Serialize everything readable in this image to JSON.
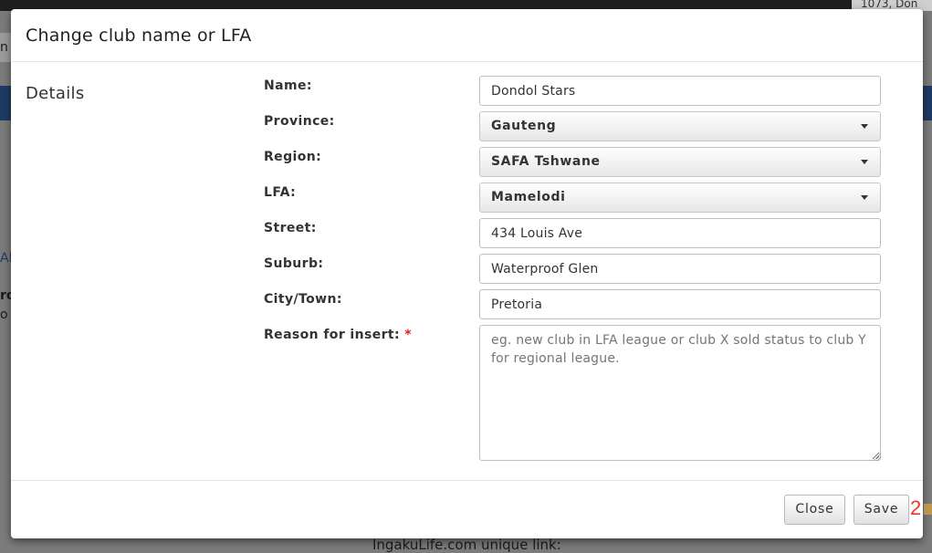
{
  "background": {
    "topbar_text": "1073, Don",
    "left_fragments": [
      "n",
      "AF",
      "ro",
      "o"
    ],
    "bottom_text": "IngakuLife.com unique link:"
  },
  "modal": {
    "title": "Change club name or LFA",
    "section_title": "Details",
    "fields": {
      "name": {
        "label": "Name:",
        "value": "Dondol Stars"
      },
      "province": {
        "label": "Province:",
        "value": "Gauteng"
      },
      "region": {
        "label": "Region:",
        "value": "SAFA Tshwane"
      },
      "lfa": {
        "label": "LFA:",
        "value": "Mamelodi"
      },
      "street": {
        "label": "Street:",
        "value": "434 Louis Ave"
      },
      "suburb": {
        "label": "Suburb:",
        "value": "Waterproof Glen"
      },
      "city": {
        "label": "City/Town:",
        "value": "Pretoria"
      },
      "reason": {
        "label": "Reason for insert:",
        "required_mark": "*",
        "placeholder": "eg. new club in LFA league or club X sold status to club Y for regional league."
      }
    },
    "buttons": {
      "close": "Close",
      "save": "Save"
    }
  },
  "overlay_badge": "2"
}
